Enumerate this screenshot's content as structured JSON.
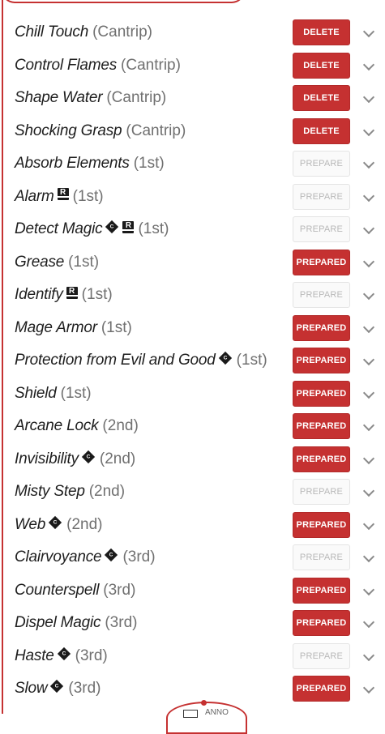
{
  "colors": {
    "accent": "#c53131",
    "level_text": "#707070",
    "prepare_text": "#b8b8b8"
  },
  "icons": {
    "ritual": "ritual-icon",
    "concentration": "concentration-icon",
    "expand": "chevron-down-icon"
  },
  "tag_glyphs": {
    "ritual": "R",
    "concentration": "C"
  },
  "footer": {
    "partial_label": "ANNO"
  },
  "spells": [
    {
      "name": "Chill Touch",
      "level": "(Cantrip)",
      "tags": [],
      "action": "DELETE"
    },
    {
      "name": "Control Flames",
      "level": "(Cantrip)",
      "tags": [],
      "action": "DELETE"
    },
    {
      "name": "Shape Water",
      "level": "(Cantrip)",
      "tags": [],
      "action": "DELETE"
    },
    {
      "name": "Shocking Grasp",
      "level": "(Cantrip)",
      "tags": [],
      "action": "DELETE"
    },
    {
      "name": "Absorb Elements",
      "level": "(1st)",
      "tags": [],
      "action": "PREPARE"
    },
    {
      "name": "Alarm",
      "level": "(1st)",
      "tags": [
        "ritual"
      ],
      "action": "PREPARE"
    },
    {
      "name": "Detect Magic",
      "level": "(1st)",
      "tags": [
        "concentration",
        "ritual"
      ],
      "action": "PREPARE"
    },
    {
      "name": "Grease",
      "level": "(1st)",
      "tags": [],
      "action": "PREPARED"
    },
    {
      "name": "Identify",
      "level": "(1st)",
      "tags": [
        "ritual"
      ],
      "action": "PREPARE"
    },
    {
      "name": "Mage Armor",
      "level": "(1st)",
      "tags": [],
      "action": "PREPARED"
    },
    {
      "name": "Protection from Evil and Good",
      "level": "(1st)",
      "tags": [
        "concentration"
      ],
      "action": "PREPARED"
    },
    {
      "name": "Shield",
      "level": "(1st)",
      "tags": [],
      "action": "PREPARED"
    },
    {
      "name": "Arcane Lock",
      "level": "(2nd)",
      "tags": [],
      "action": "PREPARED"
    },
    {
      "name": "Invisibility",
      "level": "(2nd)",
      "tags": [
        "concentration"
      ],
      "action": "PREPARED"
    },
    {
      "name": "Misty Step",
      "level": "(2nd)",
      "tags": [],
      "action": "PREPARE"
    },
    {
      "name": "Web",
      "level": "(2nd)",
      "tags": [
        "concentration"
      ],
      "action": "PREPARED"
    },
    {
      "name": "Clairvoyance",
      "level": "(3rd)",
      "tags": [
        "concentration"
      ],
      "action": "PREPARE"
    },
    {
      "name": "Counterspell",
      "level": "(3rd)",
      "tags": [],
      "action": "PREPARED"
    },
    {
      "name": "Dispel Magic",
      "level": "(3rd)",
      "tags": [],
      "action": "PREPARED"
    },
    {
      "name": "Haste",
      "level": "(3rd)",
      "tags": [
        "concentration"
      ],
      "action": "PREPARE"
    },
    {
      "name": "Slow",
      "level": "(3rd)",
      "tags": [
        "concentration"
      ],
      "action": "PREPARED"
    }
  ]
}
